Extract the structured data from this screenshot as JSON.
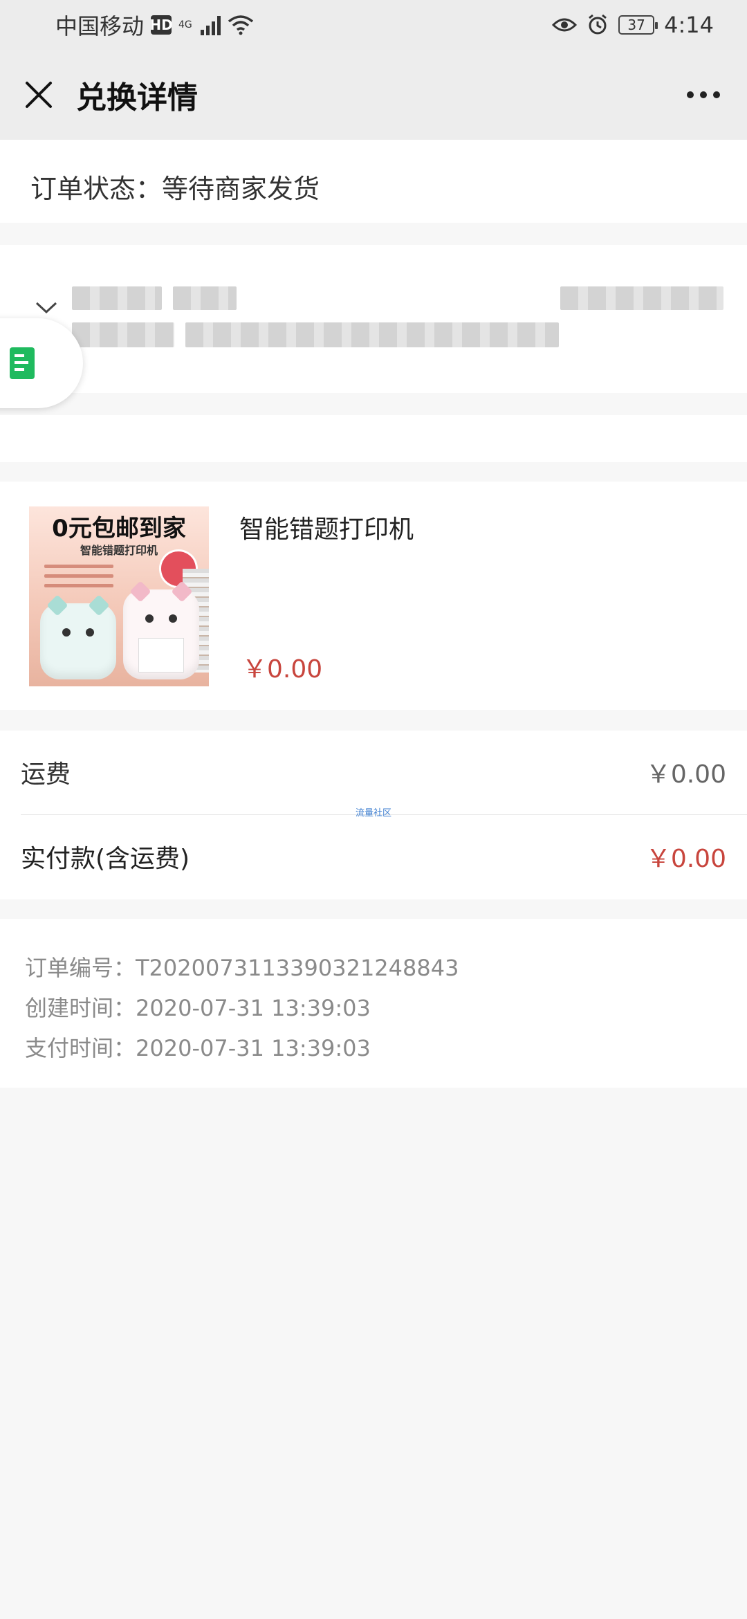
{
  "status_bar": {
    "carrier": "中国移动",
    "hd": "HD",
    "network": "4G",
    "battery": "37",
    "time": "4:14"
  },
  "nav": {
    "title": "兑换详情",
    "close_icon": "close-icon",
    "more_icon": "more-icon"
  },
  "order_status": "订单状态：等待商家发货",
  "product": {
    "image_headline": "0元包邮到家",
    "image_subtitle": "智能错题打印机",
    "name": "智能错题打印机",
    "price": "￥0.00"
  },
  "fees": {
    "shipping_label": "运费",
    "shipping_value": "￥0.00",
    "watermark": "流量社区",
    "total_label": "实付款(含运费)",
    "total_value": "￥0.00"
  },
  "order_info": {
    "order_no": "订单编号：T202007311339032124884​3",
    "created": "创建时间：2020-07-31 13:39:03",
    "paid": "支付时间：2020-07-31 13:39:03"
  },
  "colors": {
    "price_red": "#c8453d",
    "nav_bg": "#ededed",
    "float_icon_green": "#1fba5e"
  }
}
